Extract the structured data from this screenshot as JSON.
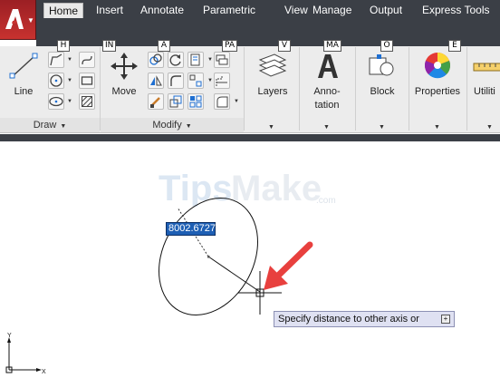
{
  "app": {
    "name": "AutoCAD"
  },
  "tabs": [
    {
      "label": "Home",
      "keytip": "H"
    },
    {
      "label": "Insert",
      "keytip": "IN"
    },
    {
      "label": "Annotate",
      "keytip": "A"
    },
    {
      "label": "Parametric",
      "keytip": "PA"
    },
    {
      "label": "View",
      "keytip": "V"
    },
    {
      "label": "Manage",
      "keytip": "MA"
    },
    {
      "label": "Output",
      "keytip": "O"
    },
    {
      "label": "Express Tools",
      "keytip": "E"
    }
  ],
  "ribbon": {
    "draw": {
      "title": "Draw",
      "line_label": "Line"
    },
    "modify": {
      "title": "Modify",
      "move_label": "Move"
    },
    "layers_label": "Layers",
    "annotation_label_1": "Anno-",
    "annotation_label_2": "tation",
    "block_label": "Block",
    "properties_label": "Properties",
    "utilities_label": "Utiliti"
  },
  "watermark": {
    "text_left": "Tips",
    "text_right": "Make",
    "suffix": ".com"
  },
  "drawing": {
    "dynamic_input_value": "8002.6727",
    "prompt": "Specify distance to other axis or",
    "ucs_y": "Y",
    "ucs_x": "X"
  },
  "colors": {
    "titlebar": "#3b3f46",
    "ribbon": "#ececec",
    "app_button": "#c8322f",
    "dyn_input": "#1e5fb4",
    "annotation_arrow": "#e8403e",
    "tooltip_bg": "#dfe1f2"
  }
}
